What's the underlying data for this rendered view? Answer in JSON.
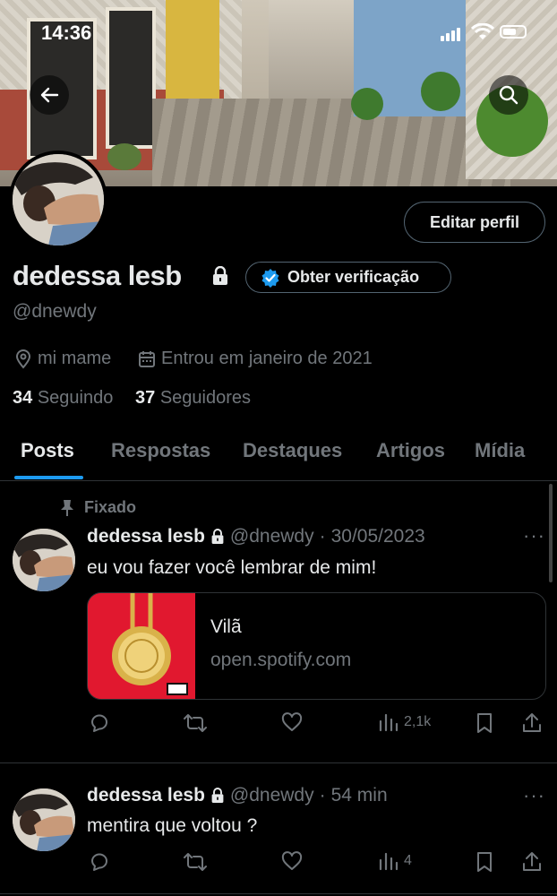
{
  "status_bar": {
    "time": "14:36"
  },
  "header": {
    "back_icon": "arrow-left-icon",
    "search_icon": "search-icon"
  },
  "profile": {
    "name": "dedessa lesb",
    "handle": "@dnewdy",
    "edit_button": "Editar perfil",
    "verify_button": "Obter verificação",
    "location": "mi mame",
    "joined": "Entrou em janeiro de 2021",
    "following_count": "34",
    "following_label": "Seguindo",
    "followers_count": "37",
    "followers_label": "Seguidores"
  },
  "tabs": [
    {
      "label": "Posts",
      "active": true
    },
    {
      "label": "Respostas"
    },
    {
      "label": "Destaques"
    },
    {
      "label": "Artigos"
    },
    {
      "label": "Mídia"
    }
  ],
  "posts": [
    {
      "pinned_label": "Fixado",
      "author": "dedessa lesb",
      "handle": "@dnewdy",
      "separator": "·",
      "time": "30/05/2023",
      "text": "eu vou fazer você lembrar de mim!",
      "card": {
        "title": "Vilã",
        "domain": "open.spotify.com"
      },
      "views": "2,1k"
    },
    {
      "author": "dedessa lesb",
      "handle": "@dnewdy",
      "separator": "·",
      "time": "54 min",
      "text": "mentira que voltou ?",
      "views": "4"
    }
  ],
  "more_icon": "···",
  "colors": {
    "accent": "#1d9bf0",
    "muted": "#71767b",
    "text": "#e7e9ea",
    "border": "#2f3336",
    "card_image": "#e1182f"
  }
}
